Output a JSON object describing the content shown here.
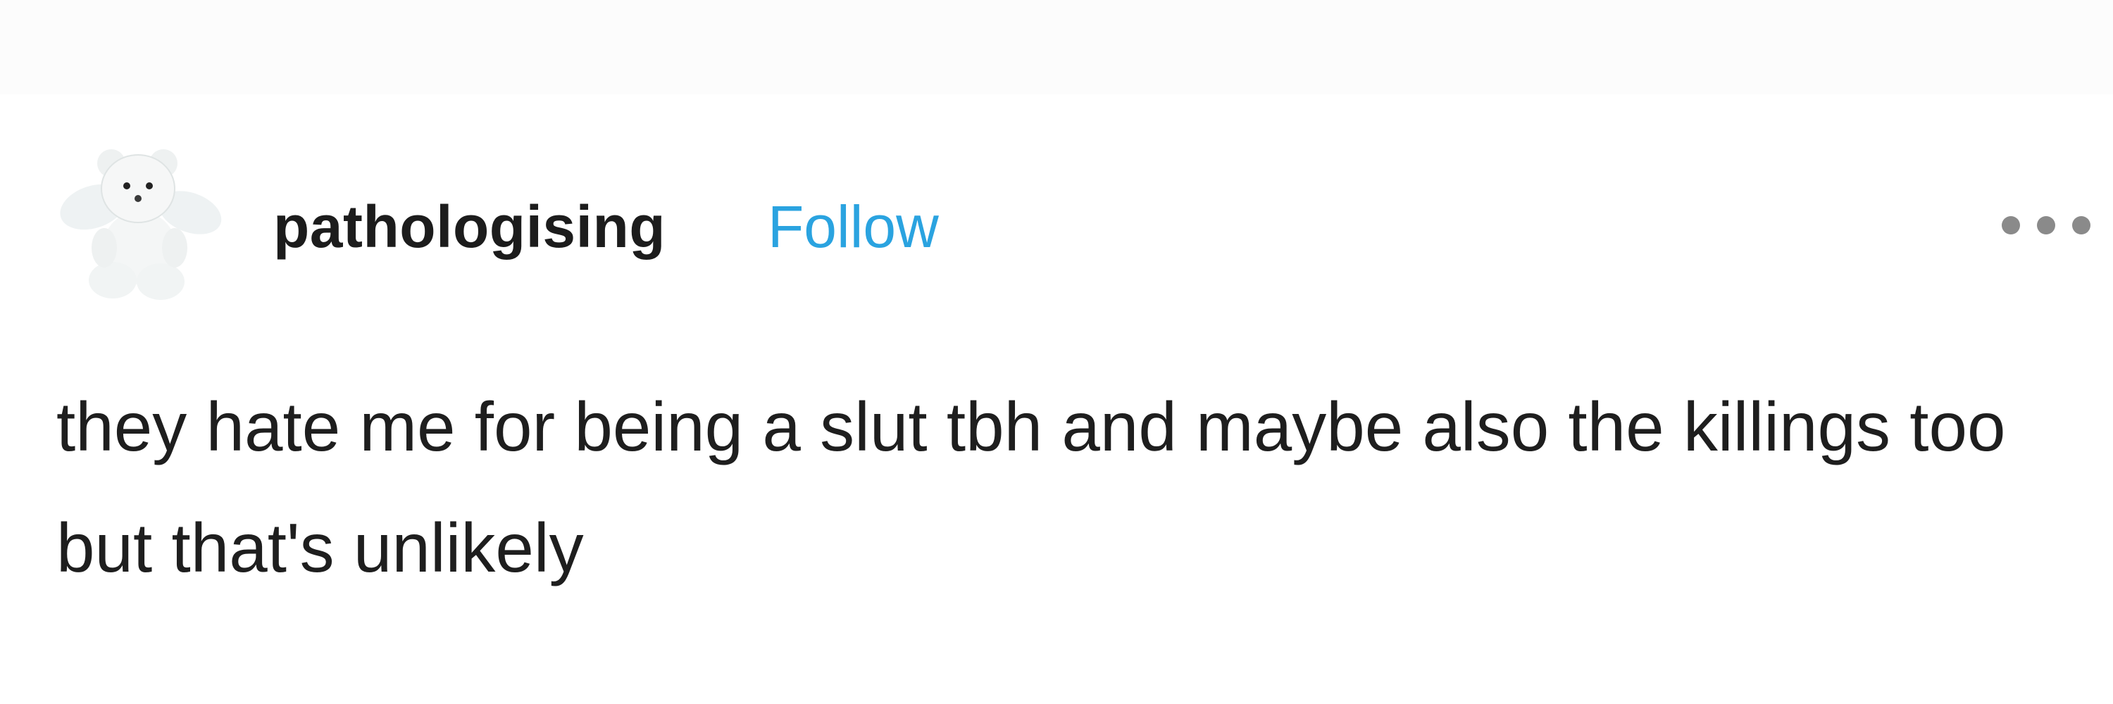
{
  "post": {
    "blog_name": "pathologising",
    "follow_label": "Follow",
    "body_text": "they hate me for being a slut tbh and maybe also the killings too but that's unlikely",
    "avatar_icon": "teddy-bear-angel-icon",
    "more_icon": "more-options-icon"
  },
  "colors": {
    "background": "#ffffff",
    "text": "#1e1e1e",
    "follow_link": "#2aa3e0",
    "more_dots": "#8a8a8a"
  }
}
